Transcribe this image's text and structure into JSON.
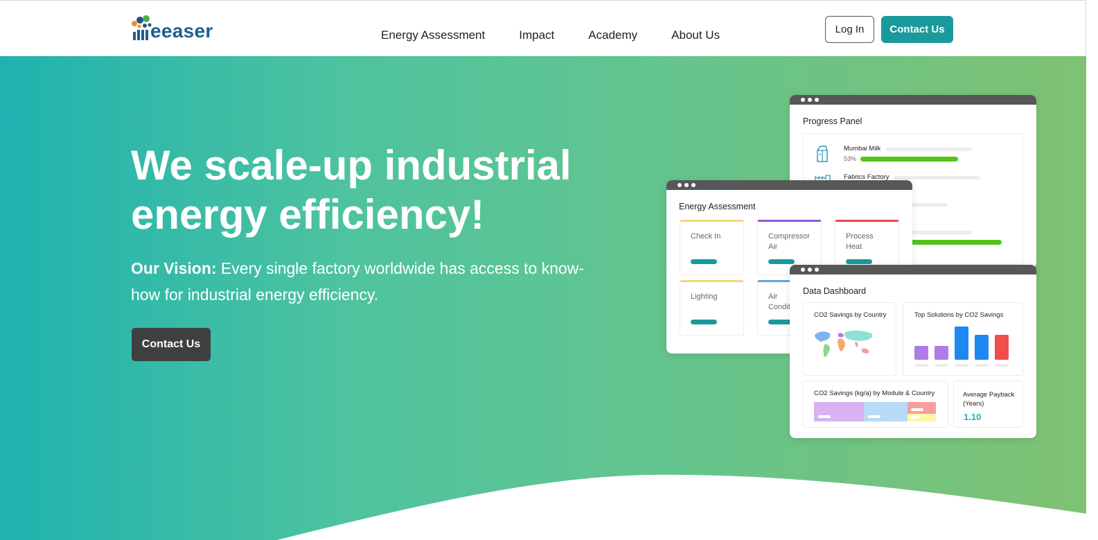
{
  "brand": {
    "name": "eeaser"
  },
  "nav": {
    "items": [
      "Energy Assessment",
      "Impact",
      "Academy",
      "About Us"
    ],
    "login_label": "Log In",
    "contact_label": "Contact Us"
  },
  "hero": {
    "title_line1": "We scale-up industrial",
    "title_line2": "energy efficiency!",
    "vision_label": "Our Vision:",
    "vision_text": " Every single factory worldwide has access to know-how for industrial energy efficiency.",
    "cta_label": "Contact Us"
  },
  "progress_panel": {
    "title": "Progress Panel",
    "items": [
      {
        "name": "Mumbai Milk",
        "percent_label": "53%",
        "progress": 0.53
      },
      {
        "name": "Fabrics Factory"
      }
    ]
  },
  "energy_assessment": {
    "title": "Energy Assessment",
    "modules": [
      {
        "label": "Check In",
        "color": "#f5d76e"
      },
      {
        "label": "Compressor Air",
        "color": "#8e5bd8"
      },
      {
        "label": "Process Heat",
        "color": "#e8484a"
      },
      {
        "label": "Lighting",
        "color": "#f5d76e"
      },
      {
        "label": "Air Conditioning",
        "color": "#59a8e8"
      }
    ]
  },
  "data_dashboard": {
    "title": "Data Dashboard",
    "co2_by_country_title": "CO2 Savings by Country",
    "top_solutions_title": "Top Solutions by CO2 Savings",
    "top_solutions_colors": [
      "#b07ce8",
      "#b07ce8",
      "#1e88f2",
      "#1e88f2",
      "#f24d4d"
    ],
    "module_country_title": "CO2 Savings (kg/a) by Module & Country",
    "payback_title": "Average Payback (Years)",
    "payback_value": "1.10"
  },
  "colors": {
    "accent": "#1a9a9c",
    "brand_text": "#1d5f8d",
    "dark_button": "#3f3f3f",
    "progress_green": "#52c41a"
  }
}
